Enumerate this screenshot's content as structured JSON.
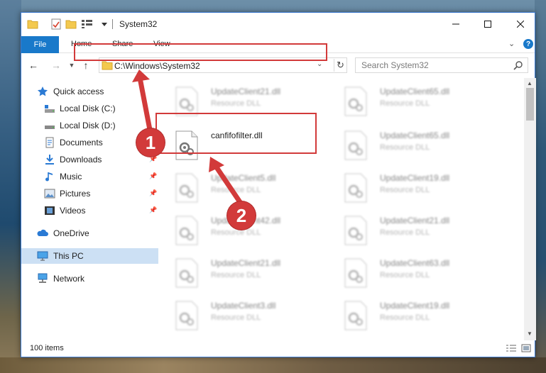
{
  "window": {
    "title": "System32"
  },
  "ribbon": {
    "tabs": [
      {
        "label": "File"
      },
      {
        "label": "Home"
      },
      {
        "label": "Share"
      },
      {
        "label": "View"
      }
    ]
  },
  "address": {
    "path": "C:\\Windows\\System32"
  },
  "search": {
    "placeholder": "Search System32"
  },
  "nav_pane": {
    "items": [
      {
        "label": "Quick access",
        "icon": "star-icon"
      },
      {
        "label": "Local Disk (C:)",
        "icon": "drive-icon"
      },
      {
        "label": "Local Disk (D:)",
        "icon": "drive-icon"
      },
      {
        "label": "Documents",
        "icon": "documents-icon"
      },
      {
        "label": "Downloads",
        "icon": "download-icon"
      },
      {
        "label": "Music",
        "icon": "music-icon"
      },
      {
        "label": "Pictures",
        "icon": "pictures-icon"
      },
      {
        "label": "Videos",
        "icon": "videos-icon"
      },
      {
        "label": "OneDrive",
        "icon": "cloud-icon"
      },
      {
        "label": "This PC",
        "icon": "computer-icon",
        "selected": true
      },
      {
        "label": "Network",
        "icon": "network-icon"
      }
    ]
  },
  "files": {
    "highlighted": {
      "name": "canfifofilter.dll"
    },
    "left_column": [
      {
        "name": "UpdateClient21.dll",
        "type": "Resource DLL"
      },
      {
        "name": "UpdateClient5.dll",
        "type": "Resource DLL"
      },
      {
        "name": "UpdateClient42.dll",
        "type": "Resource DLL"
      },
      {
        "name": "UpdateClient21.dll",
        "type": "Resource DLL"
      },
      {
        "name": "UpdateClient3.dll",
        "type": "Resource DLL"
      }
    ],
    "right_column": [
      {
        "name": "UpdateClient65.dll",
        "type": "Resource DLL"
      },
      {
        "name": "UpdateClient65.dll",
        "type": "Resource DLL"
      },
      {
        "name": "UpdateClient19.dll",
        "type": "Resource DLL"
      },
      {
        "name": "UpdateClient21.dll",
        "type": "Resource DLL"
      },
      {
        "name": "UpdateClient63.dll",
        "type": "Resource DLL"
      },
      {
        "name": "UpdateClient19.dll",
        "type": "Resource DLL"
      }
    ]
  },
  "status": {
    "item_count": "100 items"
  },
  "callouts": {
    "step1": "1",
    "step2": "2"
  },
  "colors": {
    "accent": "#1979ca",
    "highlight": "#d23a3a",
    "selection": "#cce0f4"
  }
}
